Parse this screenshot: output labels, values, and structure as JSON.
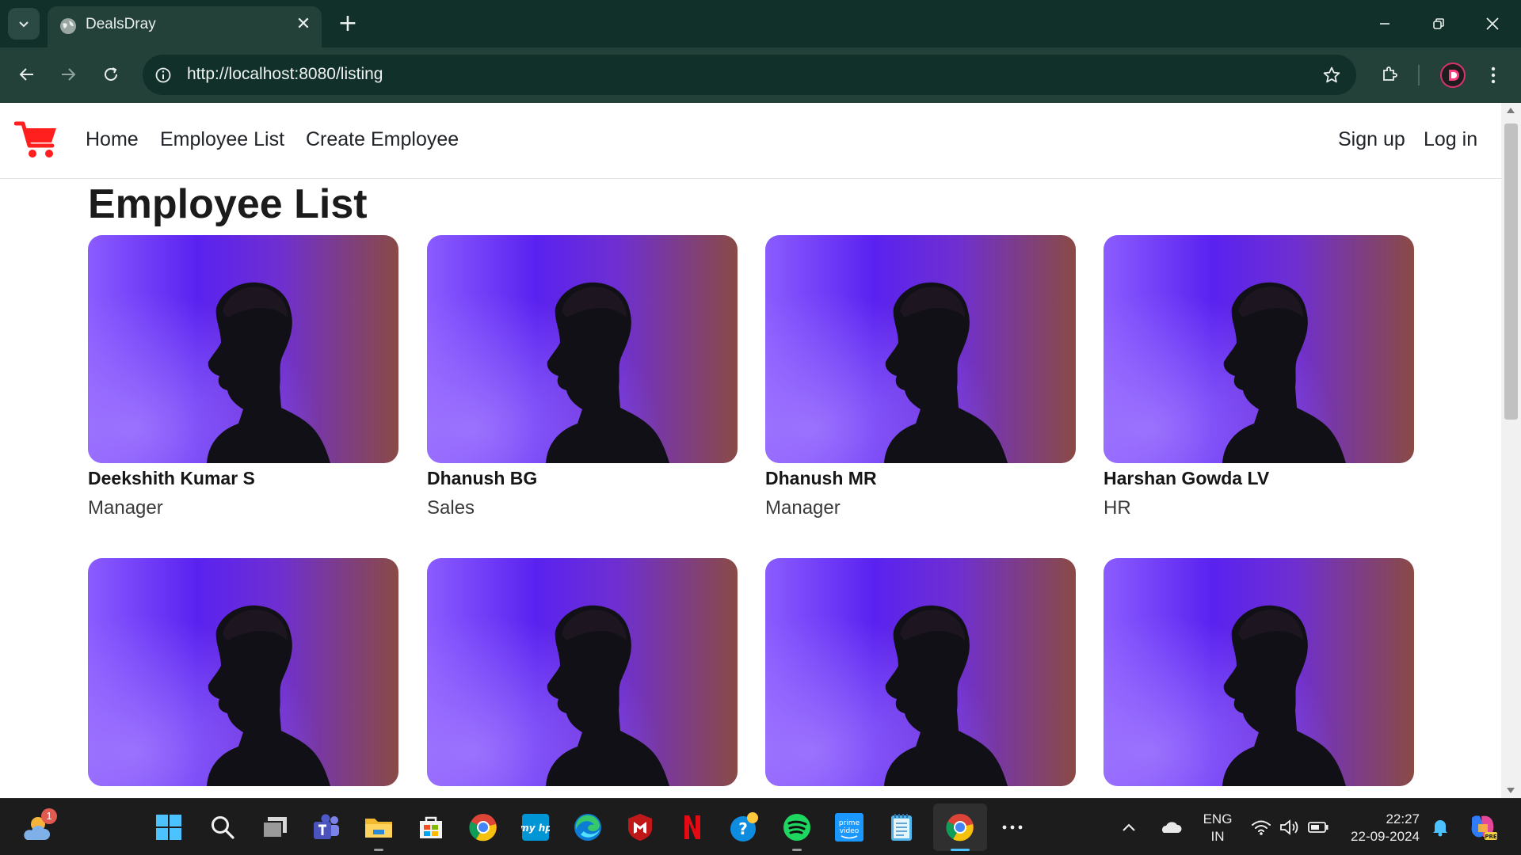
{
  "browser": {
    "tab_title": "DealsDray",
    "url": "http://localhost:8080/listing"
  },
  "site": {
    "nav_left": [
      "Home",
      "Employee List",
      "Create Employee"
    ],
    "nav_right": [
      "Sign up",
      "Log in"
    ],
    "brand_color": "#ff1f1f"
  },
  "page": {
    "title": "Employee List"
  },
  "employees": [
    {
      "name": "Deekshith Kumar S",
      "role": "Manager"
    },
    {
      "name": "Dhanush BG",
      "role": "Sales"
    },
    {
      "name": "Dhanush MR",
      "role": "Manager"
    },
    {
      "name": "Harshan Gowda LV",
      "role": "HR"
    }
  ],
  "taskbar": {
    "weather_badge": "1",
    "language_line1": "ENG",
    "language_line2": "IN",
    "time": "22:27",
    "date": "22-09-2024"
  }
}
